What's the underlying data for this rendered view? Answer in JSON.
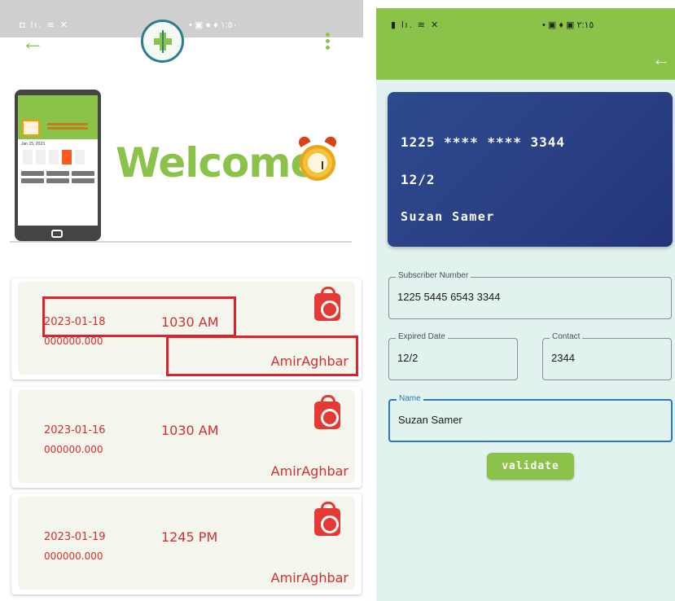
{
  "left_screen": {
    "status": {
      "left_icons": "◘ lı. ≋ ✕",
      "right_icons": "• ▣ ● ♦ ١:٥٠"
    },
    "hero": {
      "welcome_text": "Welcome",
      "mock_date": "Jan 15, 2023"
    },
    "appointments": [
      {
        "date": "2023-01-18",
        "time": "1030 AM",
        "phone": "000000.000",
        "owner": "AmirAghbar"
      },
      {
        "date": "2023-01-16",
        "time": "1030 AM",
        "phone": "000000.000",
        "owner": "AmirAghbar"
      },
      {
        "date": "2023-01-19",
        "time": "1245 PM",
        "phone": "000000.000",
        "owner": "AmirAghbar"
      }
    ]
  },
  "right_screen": {
    "status": {
      "left_icons": "▮ lı. ≋ ✕",
      "right_icons": "• ▣ ♦ ▣ ٢:١٥"
    },
    "card": {
      "number": "1225 **** **** 3344",
      "expiry": "12/2",
      "holder": "Suzan Samer"
    },
    "form": {
      "subscriber_label": "Subscriber Number",
      "subscriber_value": "1225 5445 6543 3344",
      "expired_label": "Expired Date",
      "expired_value": "12/2",
      "contact_label": "Contact",
      "contact_value": "2344",
      "name_label": "Name",
      "name_value": "Suzan Samer"
    },
    "validate_label": "validate"
  },
  "colors": {
    "brand_green": "#8bc34a",
    "card_blue": "#2b3f84",
    "accent_red": "#d32f2f",
    "focus_blue": "#2a78b8"
  }
}
